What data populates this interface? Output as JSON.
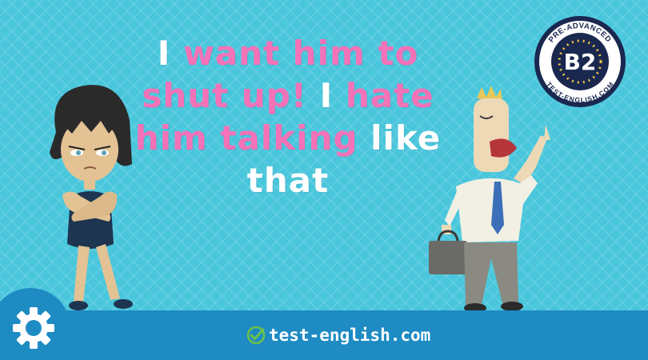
{
  "headline": {
    "segments": [
      {
        "text": "I ",
        "color": "white"
      },
      {
        "text": "want him to shut up!",
        "color": "pink"
      },
      {
        "text": " I ",
        "color": "white"
      },
      {
        "text": "hate him talking",
        "color": "pink"
      },
      {
        "text": " like that",
        "color": "white"
      }
    ],
    "line1_a": "I ",
    "line1_b": "want him to",
    "line2_a": "shut up!",
    "line2_b": " I ",
    "line2_c": "hate",
    "line3_a": "him talking",
    "line3_b": " like",
    "line4": "that"
  },
  "badge": {
    "top_text": "PRE-ADVANCED",
    "level": "B2",
    "bottom_text": "TEST-ENGLISH.COM"
  },
  "footer": {
    "site_name": "test-english.com",
    "icons": [
      "gear-icon",
      "check-circle-icon"
    ]
  },
  "colors": {
    "background": "#49c6dc",
    "pink": "#f472b8",
    "footer": "#1e8bc3",
    "badge_navy": "#1a2850",
    "check_green": "#6cc24a"
  }
}
